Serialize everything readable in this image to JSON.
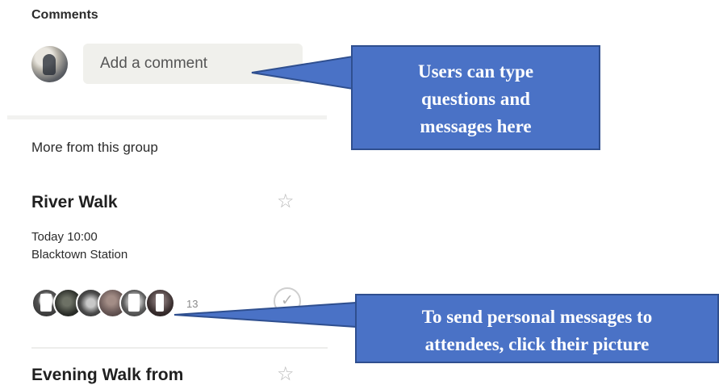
{
  "comments": {
    "section_title": "Comments",
    "input_placeholder": "Add a comment"
  },
  "more_from_group": {
    "heading": "More from this group",
    "events": [
      {
        "title": "River Walk",
        "time": "Today 10:00",
        "location": "Blacktown Station",
        "attendee_count": "13"
      },
      {
        "title": "Evening Walk from"
      }
    ]
  },
  "annotations": {
    "comment_callout": [
      "Users can type",
      "questions and",
      "messages here"
    ],
    "attendee_callout": [
      "To send personal messages to",
      "attendees, click their picture"
    ]
  },
  "icons": {
    "star": "star-outline-icon",
    "check": "checkmark-icon"
  },
  "colors": {
    "callout_fill": "#4a72c6",
    "callout_border": "#2f4f8f",
    "input_bg": "#f0f0ec"
  }
}
